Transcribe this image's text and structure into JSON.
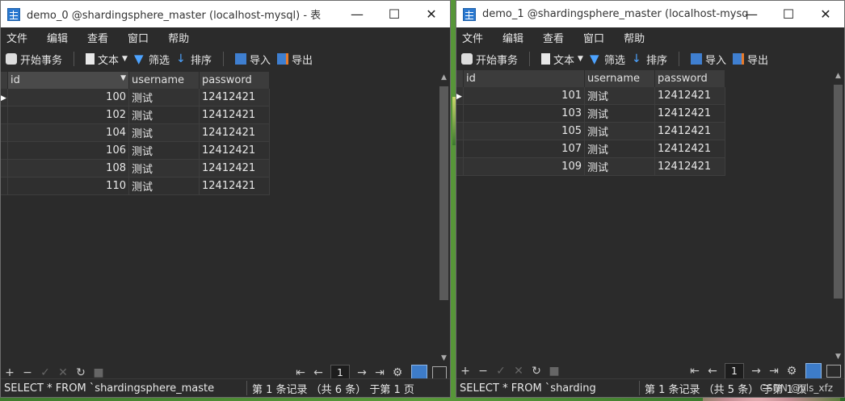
{
  "windows": [
    {
      "title": "demo_0 @shardingsphere_master (localhost-mysql) - 表",
      "menu": [
        "文件",
        "编辑",
        "查看",
        "窗口",
        "帮助"
      ],
      "toolbar": {
        "begin_tx": "开始事务",
        "text": "文本",
        "filter": "筛选",
        "sort": "排序",
        "import": "导入",
        "export": "导出"
      },
      "columns": [
        "id",
        "username",
        "password"
      ],
      "rows": [
        [
          "100",
          "测试",
          "12412421"
        ],
        [
          "102",
          "测试",
          "12412421"
        ],
        [
          "104",
          "测试",
          "12412421"
        ],
        [
          "106",
          "测试",
          "12412421"
        ],
        [
          "108",
          "测试",
          "12412421"
        ],
        [
          "110",
          "测试",
          "12412421"
        ]
      ],
      "page": "1",
      "status_sql": "SELECT * FROM `shardingsphere_maste",
      "status_records": "第 1 条记录 （共 6 条） 于第 1 页"
    },
    {
      "title": "demo_1 @shardingsphere_master (localhost-mysql...",
      "menu": [
        "文件",
        "编辑",
        "查看",
        "窗口",
        "帮助"
      ],
      "toolbar": {
        "begin_tx": "开始事务",
        "text": "文本",
        "filter": "筛选",
        "sort": "排序",
        "import": "导入",
        "export": "导出"
      },
      "columns": [
        "id",
        "username",
        "password"
      ],
      "rows": [
        [
          "101",
          "测试",
          "12412421"
        ],
        [
          "103",
          "测试",
          "12412421"
        ],
        [
          "105",
          "测试",
          "12412421"
        ],
        [
          "107",
          "测试",
          "12412421"
        ],
        [
          "109",
          "测试",
          "12412421"
        ]
      ],
      "page": "1",
      "status_sql": "SELECT * FROM `sharding",
      "status_records": "第 1 条记录 （共 5 条） 于第 1 页"
    }
  ],
  "watermark": "CSDN @yls_xfz"
}
